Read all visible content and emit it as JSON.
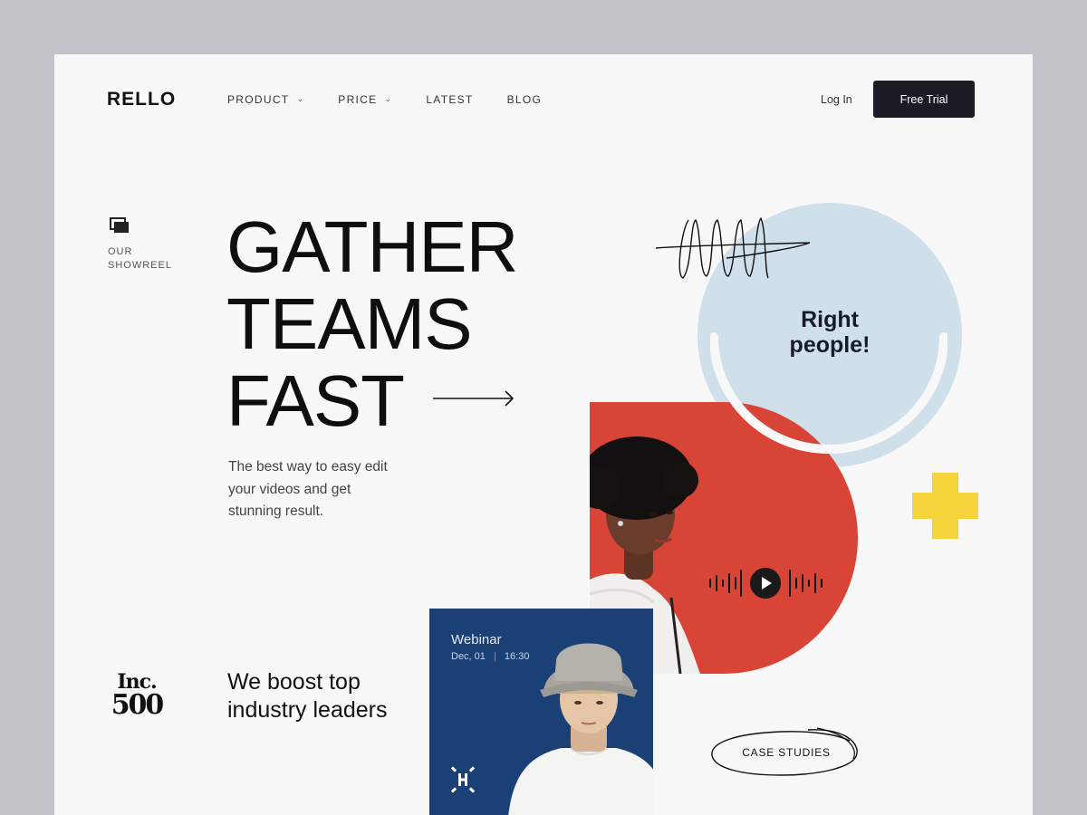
{
  "brand": {
    "logo": "RELLO"
  },
  "nav": {
    "items": [
      {
        "label": "PRODUCT",
        "has_dropdown": true
      },
      {
        "label": "PRICE",
        "has_dropdown": true
      },
      {
        "label": "LATEST",
        "has_dropdown": false
      },
      {
        "label": "BLOG",
        "has_dropdown": false
      }
    ],
    "login": "Log In",
    "cta": "Free Trial"
  },
  "showreel": {
    "label_line1": "OUR",
    "label_line2": "SHOWREEL",
    "icon": "layers-icon"
  },
  "hero": {
    "headline": [
      "GATHER",
      "TEAMS",
      "FAST"
    ],
    "subtitle": "The best way to easy edit  your videos and get stunning result."
  },
  "badge": {
    "line1": "Inc.",
    "line2": "500"
  },
  "boost": "We boost top industry leaders",
  "bubble": {
    "line1": "Right",
    "line2": "people!"
  },
  "webinar": {
    "title": "Webinar",
    "date": "Dec, 01",
    "time": "16:30"
  },
  "case_studies": "CASE STUDIES",
  "colors": {
    "dark": "#1d1c26",
    "accent_red": "#d84436",
    "soft_blue": "#d0e0ea",
    "navy": "#1b4076",
    "yellow": "#f6d33a",
    "background": "#f8f8f8",
    "outer": "#c0c4c8"
  }
}
